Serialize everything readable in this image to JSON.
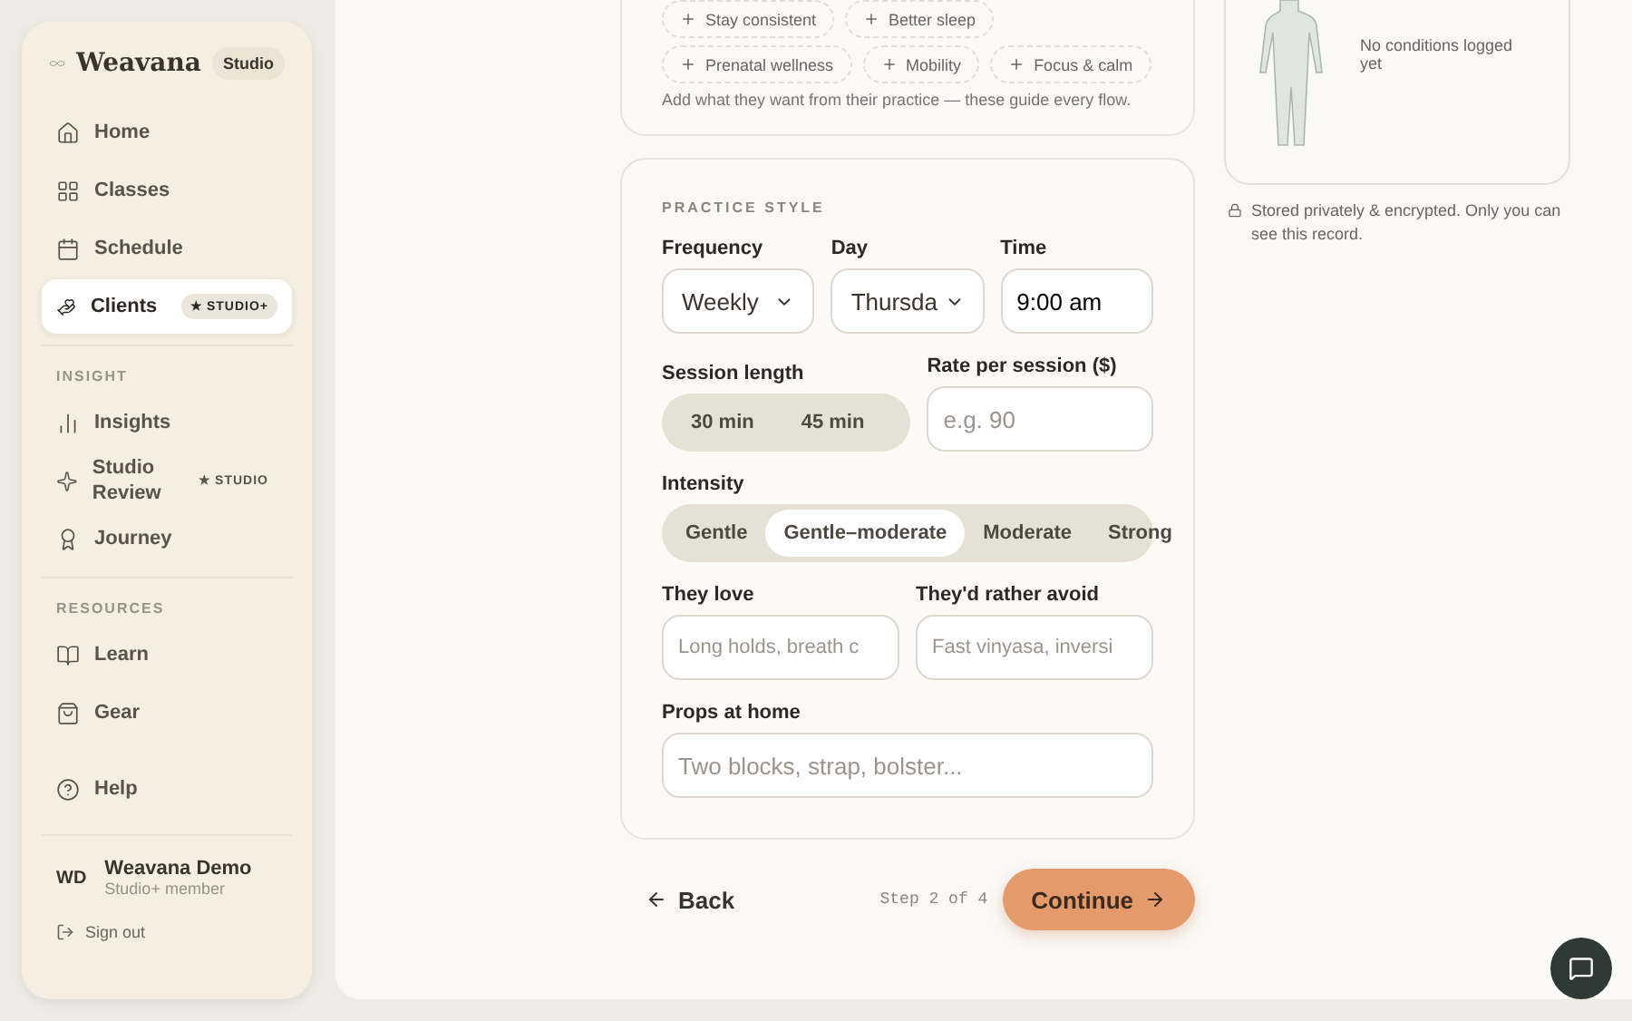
{
  "sidebar": {
    "brand": "Weavana",
    "plan_badge": "Studio",
    "groups": [
      {
        "items": [
          {
            "kind": "home",
            "label": "Home",
            "selected": false
          },
          {
            "kind": "classes",
            "label": "Classes",
            "selected": false
          },
          {
            "kind": "schedule",
            "label": "Schedule",
            "selected": false
          },
          {
            "kind": "clients",
            "label": "Clients",
            "selected": true,
            "badge": "★ STUDIO+"
          }
        ]
      },
      {
        "heading": "INSIGHT",
        "items": [
          {
            "kind": "insights",
            "label": "Insights",
            "selected": false
          },
          {
            "kind": "review",
            "label": "Studio Review",
            "selected": false,
            "badge": "★ STUDIO"
          },
          {
            "kind": "journey",
            "label": "Journey",
            "selected": false
          }
        ]
      },
      {
        "heading": "RESOURCES",
        "items": [
          {
            "kind": "learn",
            "label": "Learn",
            "selected": false
          },
          {
            "kind": "gear",
            "label": "Gear",
            "selected": false
          }
        ]
      }
    ],
    "help": "Help",
    "user": {
      "initials": "WD",
      "name": "Weavana Demo",
      "role": "Studio+ member"
    },
    "sign_out": "Sign out"
  },
  "goals": {
    "chip_rows": [
      [
        "Stay consistent",
        "Better sleep"
      ],
      [
        "Prenatal wellness",
        "Mobility",
        "Focus & calm"
      ]
    ],
    "hint": "Add what they want from their practice — these guide every flow."
  },
  "practice_style": {
    "heading": "PRACTICE STYLE",
    "frequency": {
      "label": "Frequency",
      "value": "Weekly"
    },
    "day": {
      "label": "Day",
      "value": "Thursda"
    },
    "time": {
      "label": "Time",
      "value": "9:00 am"
    },
    "session_length": {
      "label": "Session length",
      "options": [
        {
          "label": "30 min",
          "selected": false
        },
        {
          "label": "45 min",
          "selected": false
        }
      ]
    },
    "rate": {
      "label": "Rate per session ($)",
      "placeholder": "e.g. 90"
    },
    "intensity": {
      "label": "Intensity",
      "options": [
        {
          "label": "Gentle",
          "selected": false
        },
        {
          "label": "Gentle–moderate",
          "selected": true
        },
        {
          "label": "Moderate",
          "selected": false
        },
        {
          "label": "Strong",
          "selected": false
        }
      ]
    },
    "love": {
      "label": "They love",
      "placeholder": "Long holds, breath c"
    },
    "avoid": {
      "label": "They'd rather avoid",
      "placeholder": "Fast vinyasa, inversi"
    },
    "props": {
      "label": "Props at home",
      "placeholder": "Two blocks, strap, bolster..."
    }
  },
  "footer": {
    "back": "Back",
    "step": "Step 2 of 4",
    "continue": "Continue"
  },
  "body_map": {
    "empty": "No conditions logged yet",
    "privacy": "Stored privately & encrypted. Only you can see this record."
  }
}
